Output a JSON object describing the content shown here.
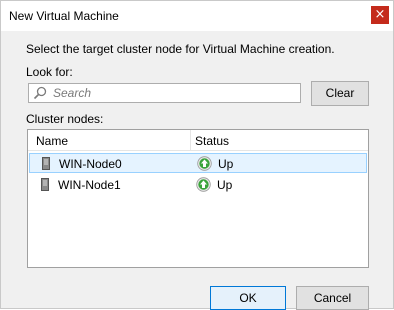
{
  "window": {
    "title": "New Virtual Machine",
    "close_symbol": "×"
  },
  "dialog": {
    "instruction": "Select the target cluster node for Virtual Machine creation.",
    "look_for_label": "Look for:",
    "search": {
      "placeholder": "Search",
      "value": ""
    },
    "clear_label": "Clear",
    "cluster_nodes_label": "Cluster nodes:",
    "columns": [
      "Name",
      "Status"
    ],
    "nodes": [
      {
        "name": "WIN-Node0",
        "status": "Up",
        "selected": true
      },
      {
        "name": "WIN-Node1",
        "status": "Up",
        "selected": false
      }
    ],
    "ok_label": "OK",
    "cancel_label": "Cancel"
  },
  "icons": {
    "close": "close-icon",
    "search": "search-icon",
    "server": "server-icon",
    "status_up": "status-up-icon"
  },
  "colors": {
    "close_button": "#c42b1c",
    "selection_bg": "#e5f3ff",
    "selection_border": "#99d1ff",
    "status_up": "#3aa33a",
    "ok_border": "#0078d7"
  }
}
